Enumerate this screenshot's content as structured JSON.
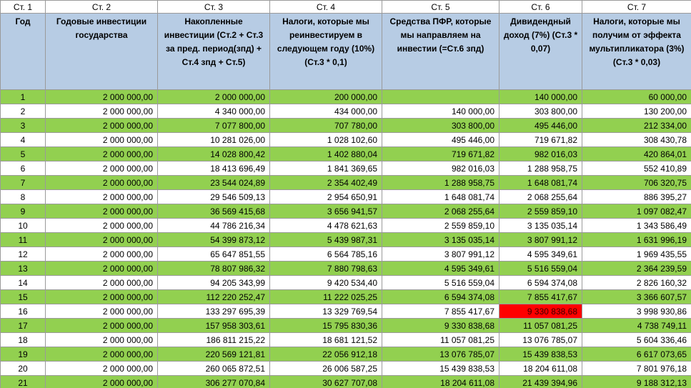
{
  "column_numbers": [
    "Ст. 1",
    "Ст. 2",
    "Ст. 3",
    "Ст. 4",
    "Ст. 5",
    "Ст. 6",
    "Ст. 7"
  ],
  "headers": [
    "Год",
    "Годовые инвестиции государства",
    "Накопленные инвестиции (Ст.2 + Ст.3 за пред. период(зпд) + Ст.4 зпд + Ст.5)",
    "Налоги, которые мы реинвестируем в следующем году (10%) (Ст.3 * 0,1)",
    "Средства ПФР, которые мы направляем на инвестии (=Ст.6 зпд)",
    "Дивидендный доход (7%) (Ст.3 * 0,07)",
    "Налоги, которые мы получим от эффекта мультипликатора (3%) (Ст.3 * 0,03)"
  ],
  "colors": {
    "header_bg": "#b7cce4",
    "row_green": "#92d050",
    "row_white": "#ffffff",
    "highlight": "#ff0000"
  },
  "highlight_cell": {
    "row": 16,
    "col": 6
  },
  "rows": [
    [
      "1",
      "2 000 000,00",
      "2 000 000,00",
      "200 000,00",
      "",
      "140 000,00",
      "60 000,00"
    ],
    [
      "2",
      "2 000 000,00",
      "4 340 000,00",
      "434 000,00",
      "140 000,00",
      "303 800,00",
      "130 200,00"
    ],
    [
      "3",
      "2 000 000,00",
      "7 077 800,00",
      "707 780,00",
      "303 800,00",
      "495 446,00",
      "212 334,00"
    ],
    [
      "4",
      "2 000 000,00",
      "10 281 026,00",
      "1 028 102,60",
      "495 446,00",
      "719 671,82",
      "308 430,78"
    ],
    [
      "5",
      "2 000 000,00",
      "14 028 800,42",
      "1 402 880,04",
      "719 671,82",
      "982 016,03",
      "420 864,01"
    ],
    [
      "6",
      "2 000 000,00",
      "18 413 696,49",
      "1 841 369,65",
      "982 016,03",
      "1 288 958,75",
      "552 410,89"
    ],
    [
      "7",
      "2 000 000,00",
      "23 544 024,89",
      "2 354 402,49",
      "1 288 958,75",
      "1 648 081,74",
      "706 320,75"
    ],
    [
      "8",
      "2 000 000,00",
      "29 546 509,13",
      "2 954 650,91",
      "1 648 081,74",
      "2 068 255,64",
      "886 395,27"
    ],
    [
      "9",
      "2 000 000,00",
      "36 569 415,68",
      "3 656 941,57",
      "2 068 255,64",
      "2 559 859,10",
      "1 097 082,47"
    ],
    [
      "10",
      "2 000 000,00",
      "44 786 216,34",
      "4 478 621,63",
      "2 559 859,10",
      "3 135 035,14",
      "1 343 586,49"
    ],
    [
      "11",
      "2 000 000,00",
      "54 399 873,12",
      "5 439 987,31",
      "3 135 035,14",
      "3 807 991,12",
      "1 631 996,19"
    ],
    [
      "12",
      "2 000 000,00",
      "65 647 851,55",
      "6 564 785,16",
      "3 807 991,12",
      "4 595 349,61",
      "1 969 435,55"
    ],
    [
      "13",
      "2 000 000,00",
      "78 807 986,32",
      "7 880 798,63",
      "4 595 349,61",
      "5 516 559,04",
      "2 364 239,59"
    ],
    [
      "14",
      "2 000 000,00",
      "94 205 343,99",
      "9 420 534,40",
      "5 516 559,04",
      "6 594 374,08",
      "2 826 160,32"
    ],
    [
      "15",
      "2 000 000,00",
      "112 220 252,47",
      "11 222 025,25",
      "6 594 374,08",
      "7 855 417,67",
      "3 366 607,57"
    ],
    [
      "16",
      "2 000 000,00",
      "133 297 695,39",
      "13 329 769,54",
      "7 855 417,67",
      "9 330 838,68",
      "3 998 930,86"
    ],
    [
      "17",
      "2 000 000,00",
      "157 958 303,61",
      "15 795 830,36",
      "9 330 838,68",
      "11 057 081,25",
      "4 738 749,11"
    ],
    [
      "18",
      "2 000 000,00",
      "186 811 215,22",
      "18 681 121,52",
      "11 057 081,25",
      "13 076 785,07",
      "5 604 336,46"
    ],
    [
      "19",
      "2 000 000,00",
      "220 569 121,81",
      "22 056 912,18",
      "13 076 785,07",
      "15 439 838,53",
      "6 617 073,65"
    ],
    [
      "20",
      "2 000 000,00",
      "260 065 872,51",
      "26 006 587,25",
      "15 439 838,53",
      "18 204 611,08",
      "7 801 976,18"
    ],
    [
      "21",
      "2 000 000,00",
      "306 277 070,84",
      "30 627 707,08",
      "18 204 611,08",
      "21 439 394,96",
      "9 188 312,13"
    ]
  ]
}
